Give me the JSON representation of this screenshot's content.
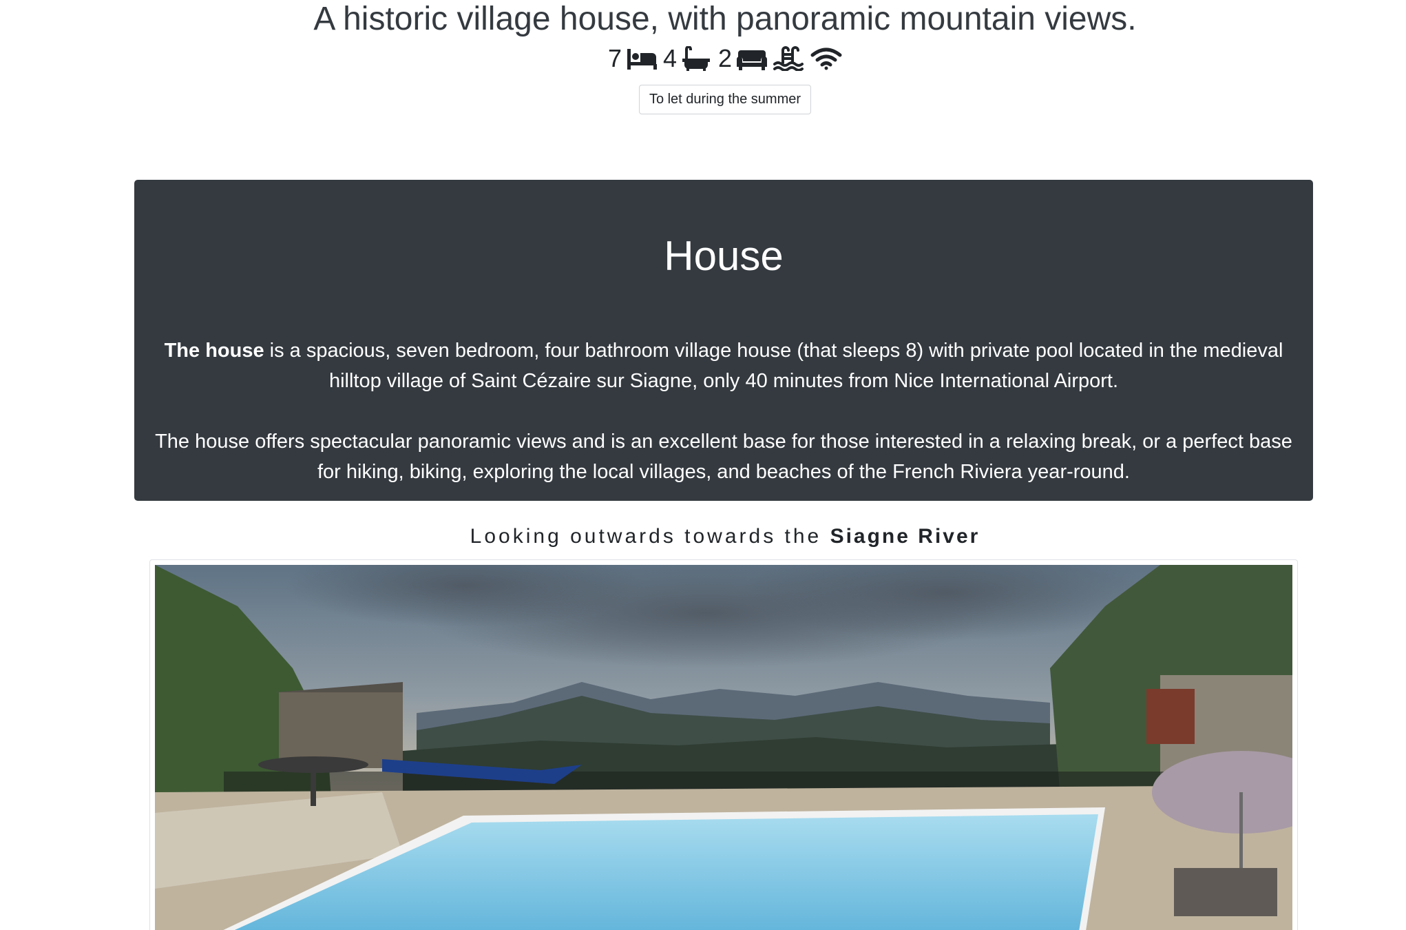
{
  "headline": "A historic village house, with panoramic mountain views.",
  "amenities": {
    "bedrooms": "7",
    "bathrooms": "4",
    "living": "2",
    "icons": [
      "bed-icon",
      "bath-icon",
      "sofa-icon",
      "pool-icon",
      "wifi-icon"
    ]
  },
  "badge": "To let during the summer",
  "house": {
    "title": "House",
    "p1_bold": "The house",
    "p1_rest": " is a spacious, seven bedroom, four bathroom village house (that sleeps 8) with private pool located in the medieval hilltop village of Saint Cézaire sur Siagne, only 40 minutes from Nice International Airport.",
    "p2": "The house offers spectacular panoramic views and is an excellent base for those interested in a relaxing break, or a perfect base for hiking, biking, exploring the local villages, and beaches of the French Riviera year-round."
  },
  "caption": {
    "prefix": "Looking outwards towards the ",
    "bold": "Siagne River"
  },
  "colors": {
    "card_bg": "#343a40",
    "text_dark": "#343a40",
    "pool": "#7ec3e0"
  }
}
